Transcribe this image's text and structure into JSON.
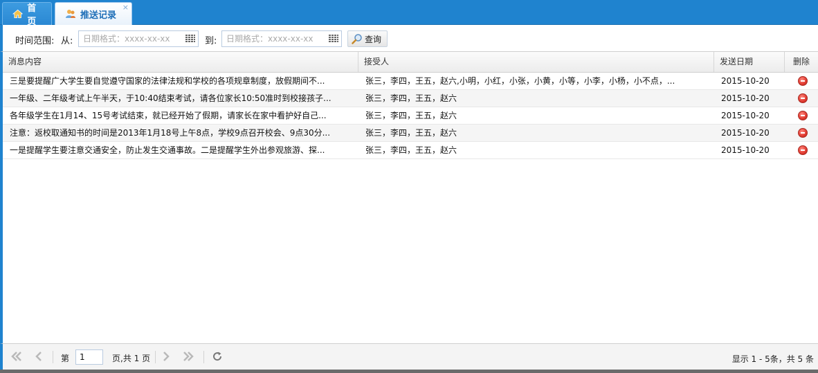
{
  "tabs": [
    {
      "label": "首页",
      "icon": "home-icon"
    },
    {
      "label": "推送记录",
      "icon": "users-icon",
      "closable": true,
      "close_glyph": "×"
    }
  ],
  "toolbar": {
    "range_label": "时间范围:",
    "from_label": "从:",
    "from_placeholder": "日期格式：xxxx-xx-xx",
    "to_label": "到:",
    "to_placeholder": "日期格式：xxxx-xx-xx",
    "query_label": "查询"
  },
  "grid": {
    "columns": [
      "消息内容",
      "接受人",
      "发送日期",
      "删除"
    ],
    "rows": [
      {
        "content": "三是要提醒广大学生要自觉遵守国家的法律法规和学校的各项规章制度，放假期间不...",
        "recipients": "张三，李四，王五，赵六,小明，小红，小张，小黄，小等，小李，小杨，小不点，...",
        "date": "2015-10-20"
      },
      {
        "content": "一年级、二年级考试上午半天，于10:40结束考试，请各位家长10:50准时到校接孩子...",
        "recipients": "张三，李四，王五，赵六",
        "date": "2015-10-20"
      },
      {
        "content": "各年级学生在1月14、15号考试结束，就已经开始了假期，请家长在家中看护好自己...",
        "recipients": "张三，李四，王五，赵六",
        "date": "2015-10-20"
      },
      {
        "content": "注意：返校取通知书的时间是2013年1月18号上午8点，学校9点召开校会、9点30分...",
        "recipients": "张三，李四，王五，赵六",
        "date": "2015-10-20"
      },
      {
        "content": "一是提醒学生要注意交通安全，防止发生交通事故。二是提醒学生外出参观旅游、探...",
        "recipients": "张三，李四，王五，赵六",
        "date": "2015-10-20"
      }
    ]
  },
  "pager": {
    "page_prefix": "第",
    "page_value": "1",
    "page_suffix": "页,共 1 页",
    "info": "显示 1 - 5条，共 5 条"
  },
  "colors": {
    "accent": "#1f83cf",
    "delete": "#e0392f"
  }
}
